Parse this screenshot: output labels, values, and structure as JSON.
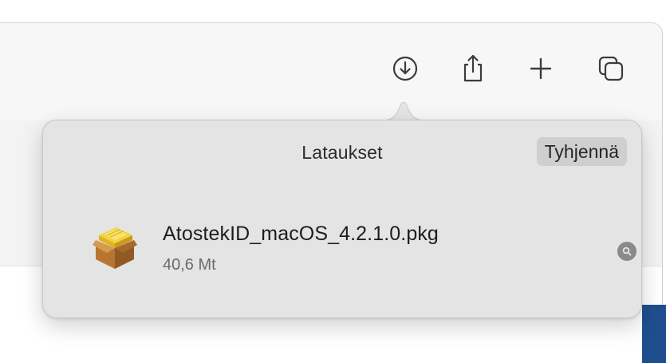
{
  "toolbar": {
    "buttons": [
      {
        "name": "downloads-icon"
      },
      {
        "name": "share-icon"
      },
      {
        "name": "new-tab-icon"
      },
      {
        "name": "tab-overview-icon"
      }
    ]
  },
  "downloads_popover": {
    "title": "Lataukset",
    "clear_label": "Tyhjennä",
    "items": [
      {
        "file_name": "AtostekID_macOS_4.2.1.0.pkg",
        "size": "40,6 Mt",
        "icon": "package-icon",
        "action_icon": "magnifier-icon"
      }
    ]
  },
  "colors": {
    "popover_bg": "#e4e4e4",
    "clear_button_bg": "#cfcfcf",
    "side_strip": "#1f4e8f"
  }
}
